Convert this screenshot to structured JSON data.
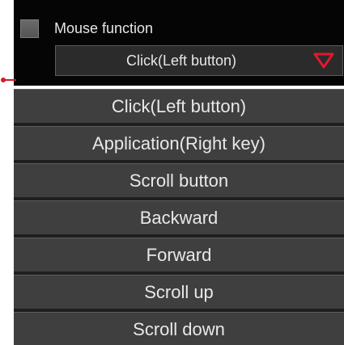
{
  "mouse_function": {
    "label": "Mouse function",
    "checked": false,
    "selected_value": "Click(Left button)"
  },
  "dropdown": {
    "options": [
      {
        "label": "Click(Left button)"
      },
      {
        "label": "Application(Right key)"
      },
      {
        "label": "Scroll button"
      },
      {
        "label": "Backward"
      },
      {
        "label": "Forward"
      },
      {
        "label": "Scroll up"
      },
      {
        "label": "Scroll down"
      }
    ]
  },
  "icons": {
    "dropdown_arrow": "chevron-down-icon",
    "connector": "connector-icon"
  },
  "colors": {
    "panel_background": "#050505",
    "menu_item_background": "#3f3f3f",
    "accent_arrow": "#e0192f",
    "text": "#e8e8e8"
  }
}
